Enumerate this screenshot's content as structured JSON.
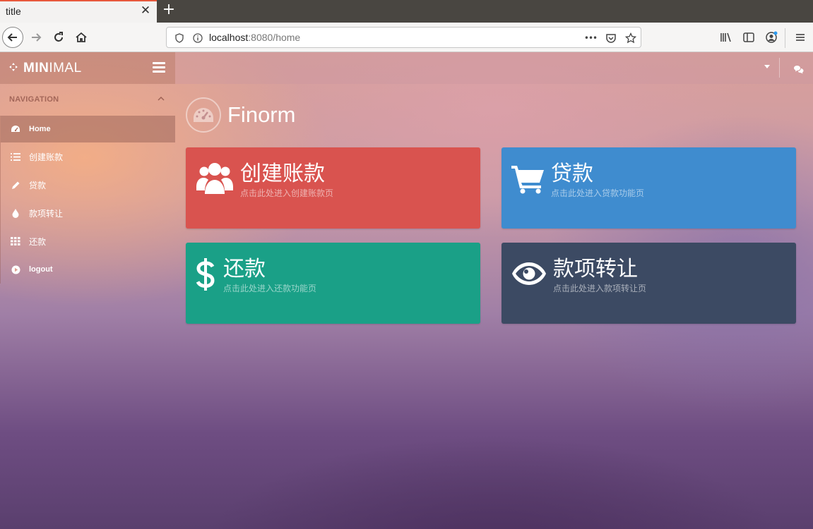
{
  "browser": {
    "tab_title": "title",
    "tab_close": "✕",
    "new_tab": "+",
    "url_host": "localhost",
    "url_rest": ":8080/home",
    "more_actions": "•••"
  },
  "sidebar": {
    "brand_bold": "MIN",
    "brand_rest": "IMAL",
    "nav_header": "NAVIGATION",
    "items": [
      {
        "label": "Home",
        "icon": "dashboard-icon",
        "active": true
      },
      {
        "label": "创建账款",
        "icon": "list-icon"
      },
      {
        "label": "贷款",
        "icon": "pencil-icon"
      },
      {
        "label": "款项转让",
        "icon": "tint-icon"
      },
      {
        "label": "还款",
        "icon": "grid-icon"
      },
      {
        "label": "logout",
        "icon": "play-circle-icon"
      }
    ]
  },
  "main": {
    "title": "Finorm",
    "cards": [
      {
        "title": "创建账款",
        "desc": "点击此处进入创建账款页",
        "icon": "users-icon",
        "color": "#d9534f"
      },
      {
        "title": "贷款",
        "desc": "点击此处进入贷款功能页",
        "icon": "shopping-cart-icon",
        "color": "#3f8ccf"
      },
      {
        "title": "还款",
        "desc": "点击此处进入还款功能页",
        "icon": "dollar-icon",
        "color": "#1aa087"
      },
      {
        "title": "款项转让",
        "desc": "点击此处进入款项转让页",
        "icon": "eye-icon",
        "color": "#3c4a63"
      }
    ]
  }
}
